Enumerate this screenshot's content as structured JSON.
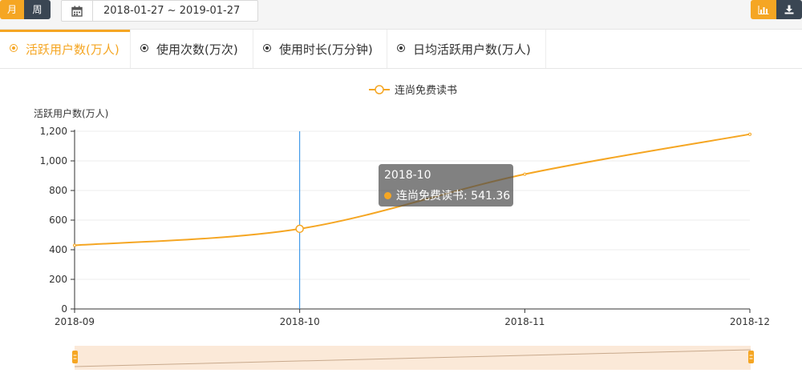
{
  "toolbar": {
    "month_label": "月",
    "week_label": "周",
    "date_range": "2018-01-27 ~ 2019-01-27",
    "calendar_icon": "calendar-icon",
    "chart_icon": "bar-chart-icon",
    "download_icon": "download-icon"
  },
  "tabs": [
    {
      "label": "活跃用户数(万人)",
      "active": true
    },
    {
      "label": "使用次数(万次)",
      "active": false
    },
    {
      "label": "使用时长(万分钟)",
      "active": false
    },
    {
      "label": "日均活跃用户数(万人)",
      "active": false
    }
  ],
  "colors": {
    "accent": "#f5a623",
    "dark": "#3a4653",
    "cursor": "#1e88e5",
    "zoom_fill": "#fbe9d8"
  },
  "tooltip": {
    "title": "2018-10",
    "series": "连尚免费读书",
    "value": "541.36"
  },
  "chart_data": {
    "type": "line",
    "x": [
      "2018-09",
      "2018-10",
      "2018-11",
      "2018-12"
    ],
    "series": [
      {
        "name": "连尚免费读书",
        "values": [
          430,
          541.36,
          910,
          1180
        ]
      }
    ],
    "ylabel": "活跃用户数(万人)",
    "ylim": [
      0,
      1200
    ],
    "yticks": [
      "0",
      "200",
      "400",
      "600",
      "800",
      "1,000",
      "1,200"
    ],
    "grid": true,
    "legend": "top-center",
    "highlight_index": 1
  }
}
